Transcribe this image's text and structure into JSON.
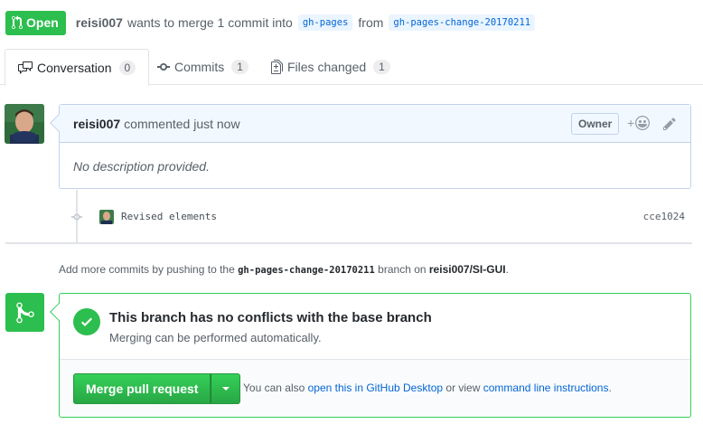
{
  "header": {
    "state_label": "Open",
    "author": "reisi007",
    "action_text": "wants to merge 1 commit into",
    "base_branch": "gh-pages",
    "from_word": "from",
    "head_branch": "gh-pages-change-20170211"
  },
  "tabs": [
    {
      "label": "Conversation",
      "count": "0"
    },
    {
      "label": "Commits",
      "count": "1"
    },
    {
      "label": "Files changed",
      "count": "1"
    }
  ],
  "comment": {
    "author": "reisi007",
    "action": "commented just now",
    "role_badge": "Owner",
    "reaction_plus": "+",
    "body": "No description provided."
  },
  "commit": {
    "message": "Revised elements",
    "sha": "cce1024"
  },
  "push_hint": {
    "prefix": "Add more commits by pushing to the",
    "branch": "gh-pages-change-20170211",
    "middle": "branch on",
    "repo": "reisi007/SI-GUI",
    "suffix": "."
  },
  "merge": {
    "title": "This branch has no conflicts with the base branch",
    "subtitle": "Merging can be performed automatically.",
    "button_label": "Merge pull request",
    "alt_prefix": "You can also",
    "alt_link1": "open this in GitHub Desktop",
    "alt_middle": "or view",
    "alt_link2": "command line instructions",
    "alt_suffix": "."
  },
  "colors": {
    "success": "#2cbe4e",
    "link": "#0366d6",
    "comment_header_bg": "#f1f8ff"
  }
}
